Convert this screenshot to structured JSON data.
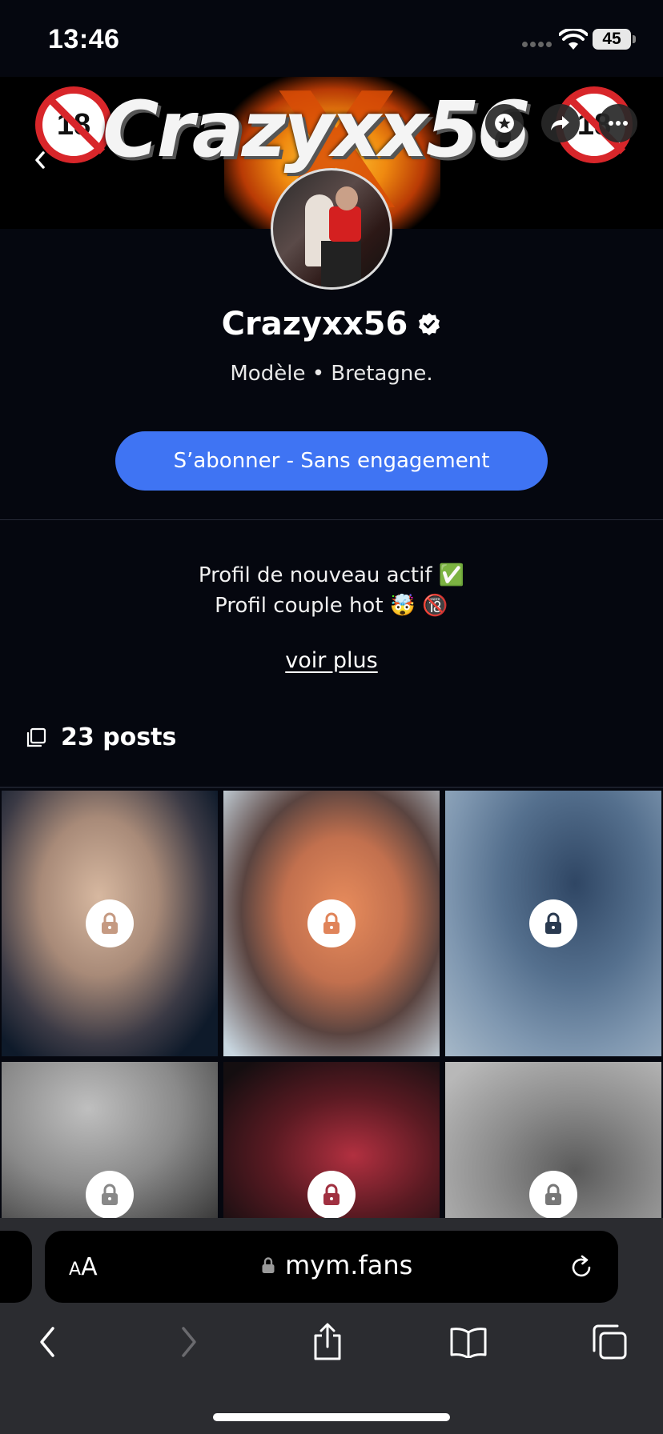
{
  "status_bar": {
    "time": "13:46",
    "battery": "45"
  },
  "banner": {
    "title": "Crazyxx56",
    "badge": "18"
  },
  "profile": {
    "name": "Crazyxx56",
    "tagline": "Modèle • Bretagne.",
    "subscribe_label": "S’abonner - Sans engagement"
  },
  "bio": {
    "line1": "Profil de nouveau actif ✅",
    "line2": "Profil couple hot 🤯 🔞",
    "see_more": "voir plus"
  },
  "posts": {
    "count_label": "23 posts",
    "tiles": [
      {
        "locked": true,
        "lock_color": "#c59a82"
      },
      {
        "locked": true,
        "lock_color": "#e0845a"
      },
      {
        "locked": true,
        "lock_color": "#2a3a50"
      },
      {
        "locked": true,
        "lock_color": "#888888"
      },
      {
        "locked": true,
        "lock_color": "#a03040"
      },
      {
        "locked": true,
        "lock_color": "#777777"
      }
    ]
  },
  "browser": {
    "text_size_small": "A",
    "text_size_big": "A",
    "url": "mym.fans"
  },
  "colors": {
    "background": "#05070f",
    "accent_blue": "#3f74f3",
    "safari_bar": "#2b2c30"
  },
  "icons": [
    "back-chevron-icon",
    "star-icon",
    "share-arrow-icon",
    "more-icon",
    "verified-icon",
    "posts-icon",
    "lock-icon",
    "reload-icon",
    "share-icon",
    "bookmarks-icon",
    "tabs-icon"
  ]
}
